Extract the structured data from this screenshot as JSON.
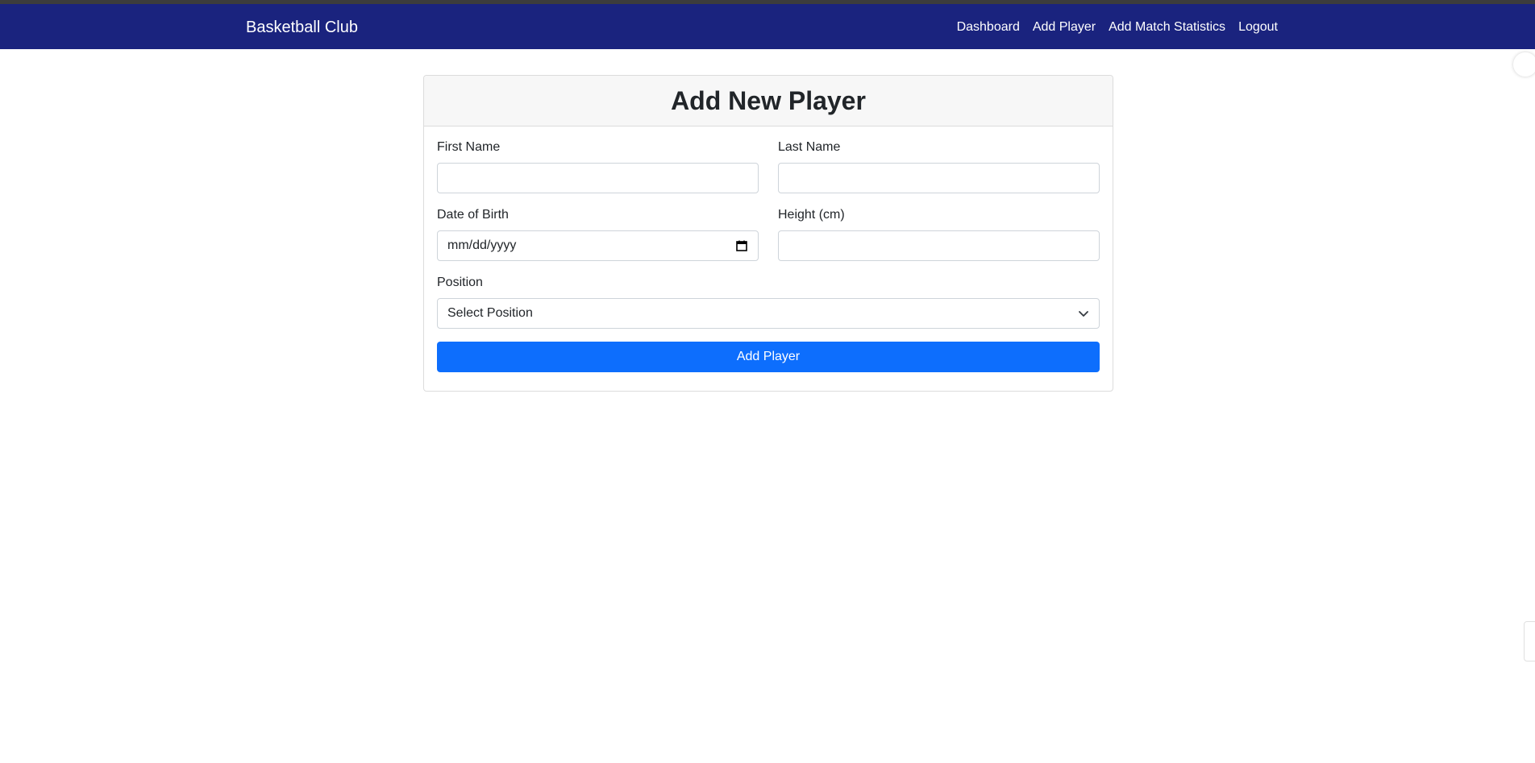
{
  "navbar": {
    "brand": "Basketball Club",
    "links": [
      "Dashboard",
      "Add Player",
      "Add Match Statistics",
      "Logout"
    ]
  },
  "form": {
    "title": "Add New Player",
    "first_name_label": "First Name",
    "first_name_value": "",
    "last_name_label": "Last Name",
    "last_name_value": "",
    "dob_label": "Date of Birth",
    "dob_placeholder": "mm/dd/yyyy",
    "height_label": "Height (cm)",
    "height_value": "",
    "position_label": "Position",
    "position_selected": "Select Position",
    "submit_label": "Add Player"
  },
  "colors": {
    "navbar_bg": "#1a237e",
    "primary_button": "#0d6efd"
  }
}
